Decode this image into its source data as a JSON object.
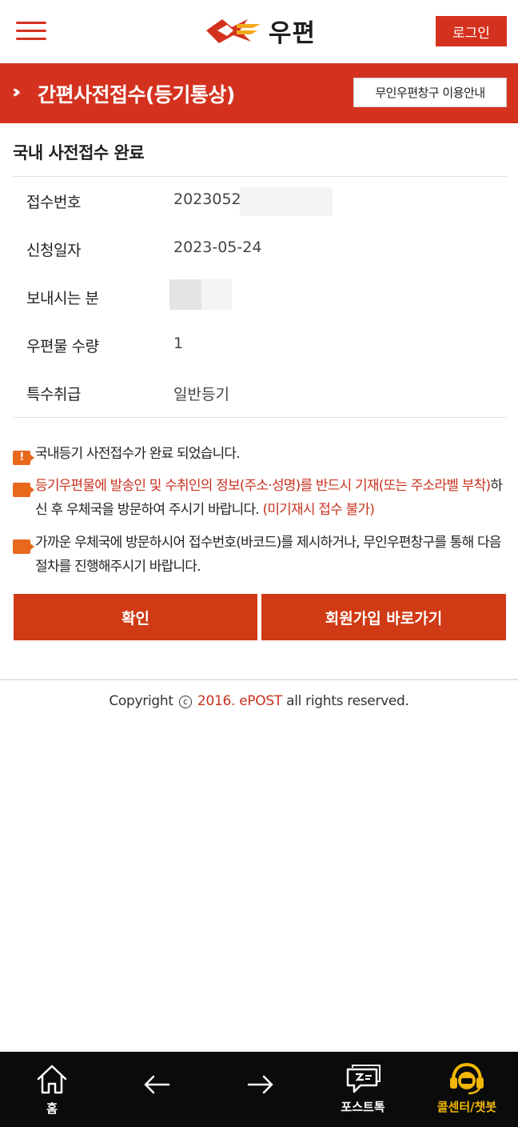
{
  "header": {
    "logo_text": "우편",
    "login_label": "로그인"
  },
  "titlebar": {
    "chevron": "»",
    "title": "간편사전접수(등기통상)",
    "guide_button": "무인우편창구 이용안내"
  },
  "section": {
    "title": "국내 사전접수 완료"
  },
  "info": [
    {
      "label": "접수번호",
      "value": "2023052"
    },
    {
      "label": "신청일자",
      "value": "2023-05-24"
    },
    {
      "label": "보내시는 분",
      "value": ""
    },
    {
      "label": "우편물 수량",
      "value": "1"
    },
    {
      "label": "특수취급",
      "value": "일반등기"
    }
  ],
  "notices": {
    "n1": "국내등기 사전접수가 완료 되었습니다.",
    "n2_red1": "등기우편물에 발송인 및 수취인의 정보(주소·성명)를 반드시 기재(또는 주소라벨 부착)",
    "n2_plain": "하신 후 우체국을 방문하여 주시기 바랍니다.",
    "n2_red2": " (미기재시 접수 불가)",
    "n3": "가까운 우체국에 방문하시어 접수번호(바코드)를 제시하거나, 무인우편창구를 통해 다음 절차를 진행해주시기 바랍니다."
  },
  "buttons": {
    "confirm": "확인",
    "signup": "회원가입 바로가기"
  },
  "footer": {
    "copyright_pre": "Copyright",
    "copyright_mark": "c",
    "copyright_year": "2016. ePOST",
    "copyright_post": "all rights reserved."
  },
  "bottom_nav": {
    "home": "홈",
    "posttalk": "포스트톡",
    "callcenter": "콜센터/챗봇"
  },
  "colors": {
    "brand_red": "#d4321f",
    "button_red": "#d03a14",
    "notice_orange": "#e8691e",
    "nav_bg": "#0b0b0b",
    "nav_gold": "#f2b705"
  }
}
